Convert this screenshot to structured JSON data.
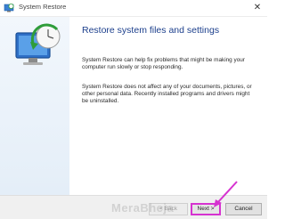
{
  "window": {
    "title": "System Restore",
    "app_icon": "system-restore-icon",
    "close_icon": "close-icon"
  },
  "side": {
    "illustration": "system-restore-illustration"
  },
  "content": {
    "heading": "Restore system files and settings",
    "para1": "System Restore can help fix problems that might be making your computer run slowly or stop responding.",
    "para2": "System Restore does not affect any of your documents, pictures, or other personal data. Recently installed programs and drivers might be uninstalled."
  },
  "footer": {
    "back_label": "< Back",
    "next_label": "Next >",
    "cancel_label": "Cancel"
  },
  "watermark": "MeraBheja",
  "colors": {
    "heading": "#1c3f8c",
    "highlight": "#d633d0"
  }
}
